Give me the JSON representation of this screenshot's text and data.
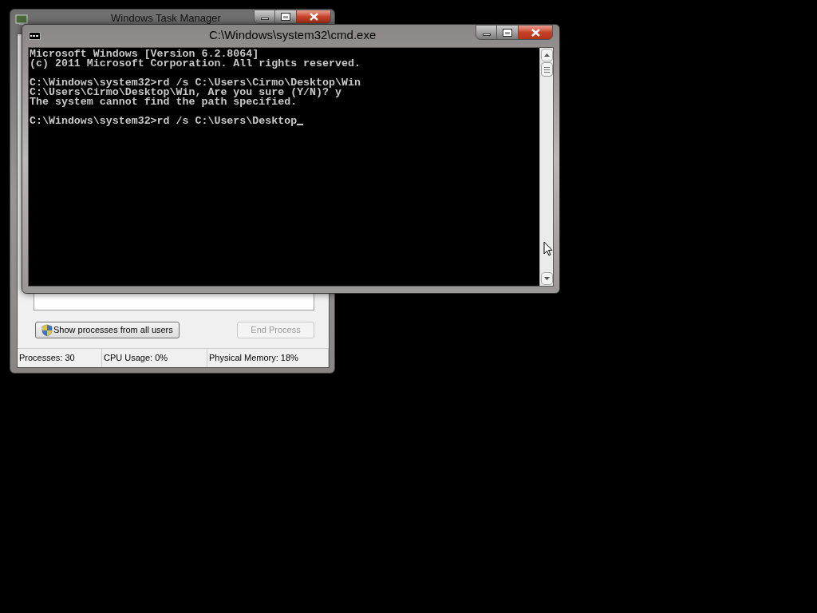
{
  "task_manager": {
    "title": "Windows Task Manager",
    "buttons": [
      {
        "label": "Show processes from all users",
        "disabled": false,
        "kind": "shield"
      },
      {
        "label": "End Process",
        "disabled": true,
        "kind": "plain"
      }
    ],
    "status_bar": [
      "Processes: 30",
      "CPU Usage: 0%",
      "Physical Memory: 18%"
    ]
  },
  "console": {
    "title": "C:\\Windows\\system32\\cmd.exe",
    "blocks": [
      [
        "Microsoft Windows [Version 6.2.8064]",
        "(c) 2011 Microsoft Corporation. All rights reserved."
      ],
      [
        "C:\\Windows\\system32>rd /s C:\\Users\\Cirmo\\Desktop\\Win",
        "C:\\Users\\Cirmo\\Desktop\\Win, Are you sure (Y/N)? y",
        "The system cannot find the path specified."
      ],
      [
        "C:\\Windows\\system32>rd /s C:\\Users\\Desktop"
      ]
    ]
  }
}
